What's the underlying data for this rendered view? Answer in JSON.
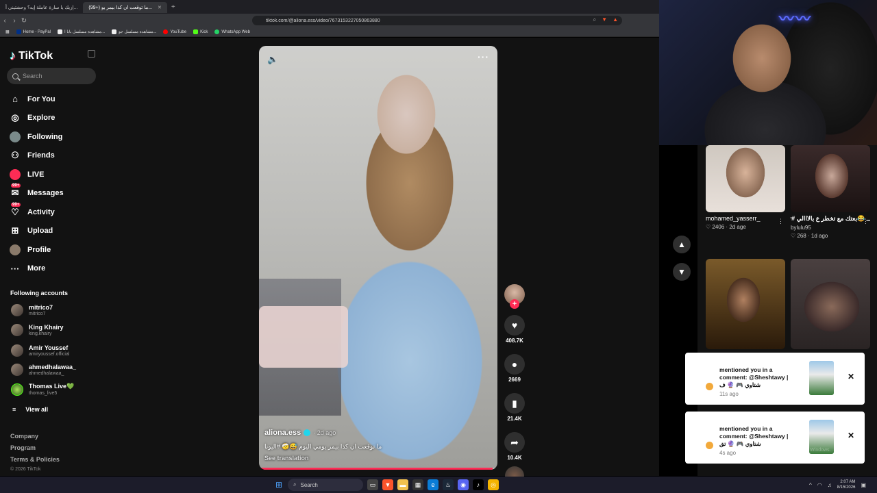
{
  "browser": {
    "tabs": [
      {
        "title": "إزيك يا سارة عاملة إيه؟ وحشتيني أ...",
        "active": false
      },
      {
        "title": "(99+) ما توقعت ان كذا بيمر يو...",
        "active": true
      }
    ],
    "url": "tiktok.com/@aliona.ess/video/7673153227050863880",
    "bookmarks": [
      "Home - PayPal",
      "مشاهدة مسلسل بابا ا...",
      "مشاهدة مسلسل جو...",
      "YouTube",
      "Kick",
      "WhatsApp Web"
    ]
  },
  "tiktok": {
    "logo": "TikTok",
    "search_placeholder": "Search",
    "nav": [
      {
        "label": "For You",
        "icon": "home-icon"
      },
      {
        "label": "Explore",
        "icon": "compass-icon"
      },
      {
        "label": "Following",
        "icon": "following-icon"
      },
      {
        "label": "Friends",
        "icon": "friends-icon"
      },
      {
        "label": "LIVE",
        "icon": "live-icon"
      },
      {
        "label": "Messages",
        "icon": "messages-icon",
        "badge": "99+"
      },
      {
        "label": "Activity",
        "icon": "activity-icon",
        "badge": "99+"
      },
      {
        "label": "Upload",
        "icon": "upload-icon"
      },
      {
        "label": "Profile",
        "icon": "profile-icon"
      },
      {
        "label": "More",
        "icon": "more-icon"
      }
    ],
    "following_title": "Following accounts",
    "accounts": [
      {
        "name": "mitrico7",
        "user": "mitrico7"
      },
      {
        "name": "King Khairy",
        "user": "king.khairy"
      },
      {
        "name": "Amir Youssef",
        "user": "amiryoussef.official"
      },
      {
        "name": "ahmedhalawaa_",
        "user": "ahmedhalawaa_"
      },
      {
        "name": "Thomas Live💚",
        "user": "thomas_live5"
      }
    ],
    "view_all": "View all",
    "footer": [
      "Company",
      "Program",
      "Terms & Policies"
    ],
    "copyright": "© 2026 TikTok"
  },
  "video": {
    "author": "aliona.ess",
    "date": "· 2d ago",
    "caption": "ما توقعت ان كذا بيمر يومي اليوم 😅🤕 #اليونا",
    "see_translation": "See translation",
    "progress_fraction": 0.98
  },
  "actions": {
    "likes": "408.7K",
    "comments": "2669",
    "saves": "21.4K",
    "shares": "10.4K"
  },
  "side_videos": [
    {
      "title": "mohamed_yasserr_",
      "likes": "2406",
      "age": "2d age"
    },
    {
      "title": "ــ 😂بعتك مع تخطر ع بالااالي #yasminabdelaziz #fy...",
      "user": "bylulu95",
      "likes": "268",
      "age": "1d ago"
    }
  ],
  "notifications": [
    {
      "text": "mentioned you in a comment: @Sheshtawy | شتاوي 🎮 🔮 ف",
      "time": "11s ago"
    },
    {
      "text": "mentioned you in a comment: @Sheshtawy | شتاوي 🎮 🔮 تق",
      "time": "4s ago"
    }
  ],
  "watermark": {
    "line1": "Activate Windows",
    "line2": "Go to Settings to activate Windows."
  },
  "taskbar": {
    "search": "Search",
    "time": "2:07 AM",
    "date": "8/15/2026"
  },
  "colors": {
    "accent": "#fe2c55",
    "bg": "#121212"
  }
}
